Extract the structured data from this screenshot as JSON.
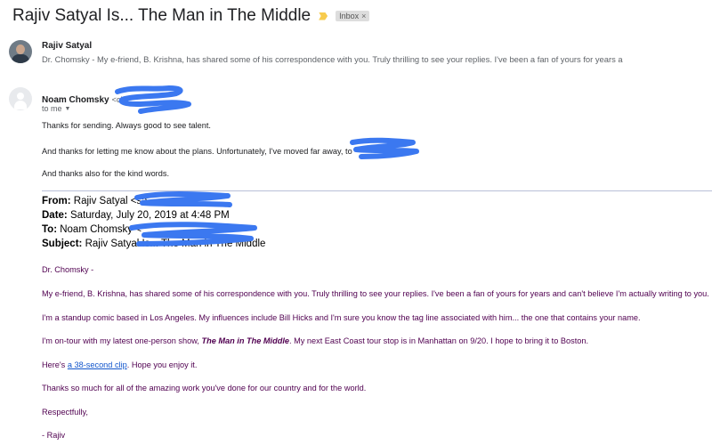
{
  "thread": {
    "subject": "Rajiv Satyal Is... The Man in The Middle",
    "label": "Inbox",
    "label_close": "×"
  },
  "first_message": {
    "sender": "Rajiv Satyal",
    "snippet": "Dr. Chomsky - My e-friend, B. Krishna, has shared some of his correspondence with you. Truly thrilling to see your replies. I've been a fan of yours for years a"
  },
  "second_message": {
    "sender_name": "Noam Chomsky",
    "sender_email_visible": "<ch",
    "recipient": "to me",
    "body": [
      "Thanks for sending.  Always good to see talent.",
      "And thanks for letting me know about the plans.  Unfortunately, I've moved far away, to",
      "And thanks also for the kind words."
    ]
  },
  "quoted_header": {
    "from_label": "From:",
    "from_value": "Rajiv Satyal <sa",
    "date_label": "Date:",
    "date_value": "Saturday, July 20, 2019 at 4:48 PM",
    "to_label": "To:",
    "to_value": "Noam Chomsky <",
    "subject_label": "Subject:",
    "subject_value": "Rajiv Satyal Is... The Man in The Middle"
  },
  "quoted_body": {
    "greeting": "Dr. Chomsky -",
    "p1": "My e-friend, B. Krishna, has shared some of his correspondence with you.  Truly thrilling to see your replies.  I've been a fan of yours for years and can't believe I'm actually writing to you.",
    "p2": "I'm a standup comic based in Los Angeles.  My influences include Bill Hicks and I'm sure you know the tag line associated with him... the one that contains your name.",
    "p3_before": "I'm on-tour with my latest one-person show, ",
    "p3_title": "The Man in The Middle",
    "p3_after": ".  My next East Coast tour stop is in Manhattan on 9/20.  I hope to bring it to Boston.",
    "p4_before": "Here's ",
    "p4_link": "a 38-second clip",
    "p4_after": ".  Hope you enjoy it.",
    "p5": "Thanks so much for all of the amazing work you've done for our country and for the world.",
    "closing": "Respectfully,",
    "signature": "- Rajiv"
  },
  "colors": {
    "redaction": "#3b78f0",
    "quoted_text": "#500050",
    "link": "#1155cc"
  }
}
